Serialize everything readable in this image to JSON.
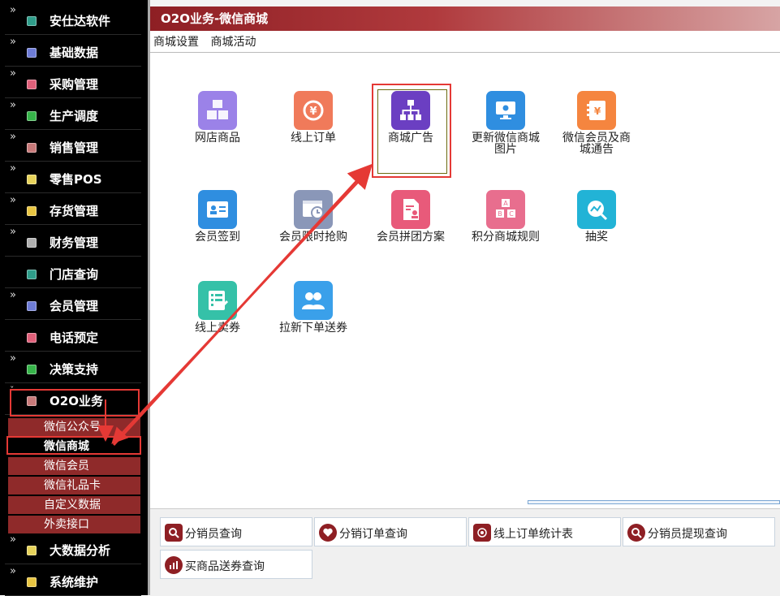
{
  "sidebar": {
    "items": [
      {
        "label": "安仕达软件",
        "color": "#2f9d8a"
      },
      {
        "label": "基础数据",
        "color": "#6e7cd6"
      },
      {
        "label": "采购管理",
        "color": "#e0607a"
      },
      {
        "label": "生产调度",
        "color": "#37b44a"
      },
      {
        "label": "销售管理",
        "color": "#c87a7a"
      },
      {
        "label": "零售POS",
        "color": "#e6d25a"
      },
      {
        "label": "存货管理",
        "color": "#e8c542"
      },
      {
        "label": "财务管理",
        "color": "#b0b0b0"
      },
      {
        "label": "门店查询",
        "color": "#2f9d8a"
      },
      {
        "label": "会员管理",
        "color": "#6e7cd6"
      },
      {
        "label": "电话预定",
        "color": "#e0607a"
      },
      {
        "label": "决策支持",
        "color": "#37b44a"
      },
      {
        "label": "O2O业务",
        "color": "#c87a7a"
      },
      {
        "label": "大数据分析",
        "color": "#e6d25a"
      },
      {
        "label": "系统维护",
        "color": "#e8c542"
      }
    ],
    "submenu": [
      "微信公众号",
      "微信商城",
      "微信会员",
      "微信礼品卡",
      "自定义数据",
      "外卖接口"
    ]
  },
  "header": {
    "title": "O2O业务-微信商城"
  },
  "tabs": [
    "商城设置",
    "商城活动"
  ],
  "apps": [
    {
      "label": "网店商品",
      "color": "#9b82e8",
      "icon": "cubes-icon"
    },
    {
      "label": "线上订单",
      "color": "#f07a5a",
      "icon": "currency-refresh-icon"
    },
    {
      "label": "商城广告",
      "color": "#6b3fc2",
      "icon": "org-chart-icon"
    },
    {
      "label": "更新微信商城图片",
      "color": "#2f8ee0",
      "icon": "monitor-gear-icon"
    },
    {
      "label": "微信会员及商城通告",
      "color": "#f5853f",
      "icon": "notice-book-icon"
    },
    {
      "label": "会员签到",
      "color": "#2f8ee0",
      "icon": "id-card-icon"
    },
    {
      "label": "会员限时抢购",
      "color": "#8a97b8",
      "icon": "timer-window-icon"
    },
    {
      "label": "会员拼团方案",
      "color": "#e85a7a",
      "icon": "document-user-icon"
    },
    {
      "label": "积分商城规则",
      "color": "#e86e8e",
      "icon": "abc-blocks-icon"
    },
    {
      "label": "抽奖",
      "color": "#22b3d6",
      "icon": "trend-search-icon"
    },
    {
      "label": "线上卖券",
      "color": "#35c1a8",
      "icon": "checklist-icon"
    },
    {
      "label": "拉新下单送券",
      "color": "#3aa0ea",
      "icon": "users-icon"
    }
  ],
  "quick": [
    "分销员查询",
    "分销订单查询",
    "线上订单统计表",
    "分销员提现查询",
    "买商品送券查询"
  ]
}
